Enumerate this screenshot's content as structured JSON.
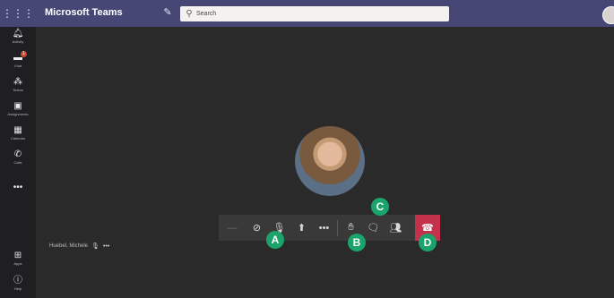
{
  "topbar": {
    "app_title": "Microsoft Teams",
    "search_placeholder": "Search",
    "icons": {
      "waffle": "app-launcher-icon",
      "compose": "compose-icon",
      "search": "search-icon"
    }
  },
  "rail": {
    "items": [
      {
        "label": "Activity",
        "icon": "bell-icon"
      },
      {
        "label": "Chat",
        "icon": "chat-icon",
        "badge": "1"
      },
      {
        "label": "Teams",
        "icon": "teams-icon"
      },
      {
        "label": "Assignments",
        "icon": "assignments-icon"
      },
      {
        "label": "Calendar",
        "icon": "calendar-icon"
      },
      {
        "label": "Calls",
        "icon": "phone-icon"
      }
    ],
    "more": "•••",
    "bottom": [
      {
        "label": "Apps",
        "icon": "apps-icon"
      },
      {
        "label": "Help",
        "icon": "help-icon"
      }
    ]
  },
  "participant": {
    "name": "Huebel, Michele"
  },
  "controls": {
    "icons": [
      "camera-off-icon",
      "mic-off-icon",
      "share-screen-icon",
      "more-options-icon",
      "raise-hand-icon",
      "chat-icon",
      "participants-icon",
      "hang-up-icon"
    ],
    "more": "•••"
  },
  "callouts": {
    "a": "A",
    "b": "B",
    "c": "C",
    "d": "D"
  },
  "colors": {
    "topbar": "#464775",
    "rail": "#1f1f22",
    "hangup": "#c4314b",
    "callout": "#1aa36a"
  }
}
